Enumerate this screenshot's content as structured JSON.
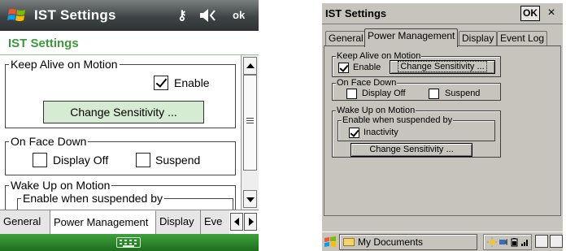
{
  "wm": {
    "title": "IST Settings",
    "ok_label": "ok",
    "header": "IST Settings",
    "keep_alive": {
      "legend": "Keep Alive on Motion",
      "enable_label": "Enable",
      "enable_checked": true,
      "button_label": "Change Sensitivity ..."
    },
    "face_down": {
      "legend": "On Face Down",
      "display_off_label": "Display Off",
      "suspend_label": "Suspend"
    },
    "wake_up": {
      "legend": "Wake Up on Motion",
      "sub_legend": "Enable when suspended by"
    },
    "tabs": [
      "General",
      "Power Management",
      "Display",
      "Eve"
    ],
    "accent_color": "#3a9a3a",
    "button_color": "#d6ecd2"
  },
  "ce": {
    "title": "IST Settings",
    "ok_label": "OK",
    "close_label": "×",
    "tabs": [
      "General",
      "Power Management",
      "Display",
      "Event Log"
    ],
    "keep_alive": {
      "legend": "Keep Alive on Motion",
      "enable_label": "Enable",
      "enable_checked": true,
      "button_label": "Change Sensitivity ..."
    },
    "face_down": {
      "legend": "On Face Down",
      "display_off_label": "Display Off",
      "suspend_label": "Suspend"
    },
    "wake_up": {
      "legend": "Wake Up on Motion",
      "sub_legend": "Enable when suspended by",
      "inactivity_label": "Inactivity",
      "inactivity_checked": true,
      "button_label": "Change Sensitivity ..."
    },
    "taskbar": {
      "task_label": "My Documents"
    },
    "face_color": "#c7c3bd"
  }
}
